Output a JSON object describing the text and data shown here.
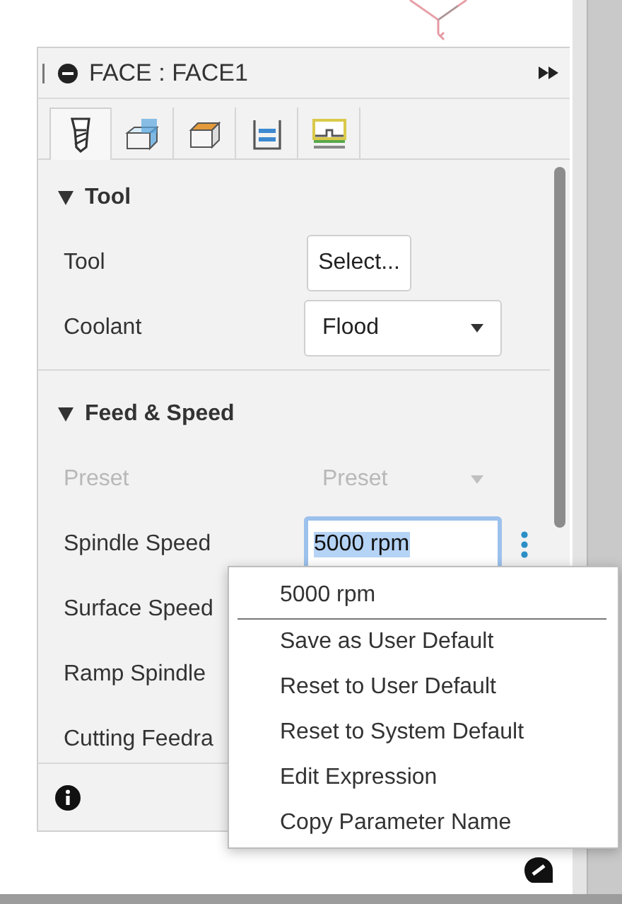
{
  "panel": {
    "title": "FACE : FACE1",
    "tabs": [
      {
        "kind": "tool",
        "selected": true
      },
      {
        "kind": "geometry",
        "selected": false
      },
      {
        "kind": "heights",
        "selected": false
      },
      {
        "kind": "passes",
        "selected": false
      },
      {
        "kind": "linking",
        "selected": false
      }
    ],
    "sections": [
      {
        "title": "Tool",
        "expanded": true,
        "rows": [
          {
            "label": "Tool",
            "kind": "button",
            "value": "Select...",
            "disabled": false
          },
          {
            "label": "Coolant",
            "kind": "select",
            "value": "Flood",
            "disabled": false
          }
        ]
      },
      {
        "title": "Feed & Speed",
        "expanded": true,
        "rows": [
          {
            "label": "Preset",
            "kind": "select",
            "value": "Preset",
            "disabled": true
          },
          {
            "label": "Spindle Speed",
            "kind": "field",
            "value": "5000 rpm",
            "disabled": false,
            "focused": true
          },
          {
            "label": "Surface Speed",
            "kind": "hidden",
            "disabled": false
          },
          {
            "label": "Ramp Spindle",
            "kind": "hidden",
            "disabled": false
          },
          {
            "label": "Cutting Feedra",
            "kind": "hidden",
            "disabled": false
          }
        ]
      }
    ]
  },
  "context_menu": {
    "items": [
      {
        "label": "5000 rpm",
        "kind": "value"
      },
      {
        "label": "Save as User Default",
        "kind": "action"
      },
      {
        "label": "Reset to User Default",
        "kind": "action"
      },
      {
        "label": "Reset to System Default",
        "kind": "action"
      },
      {
        "label": "Edit Expression",
        "kind": "action"
      },
      {
        "label": "Copy Parameter Name",
        "kind": "action"
      }
    ]
  }
}
